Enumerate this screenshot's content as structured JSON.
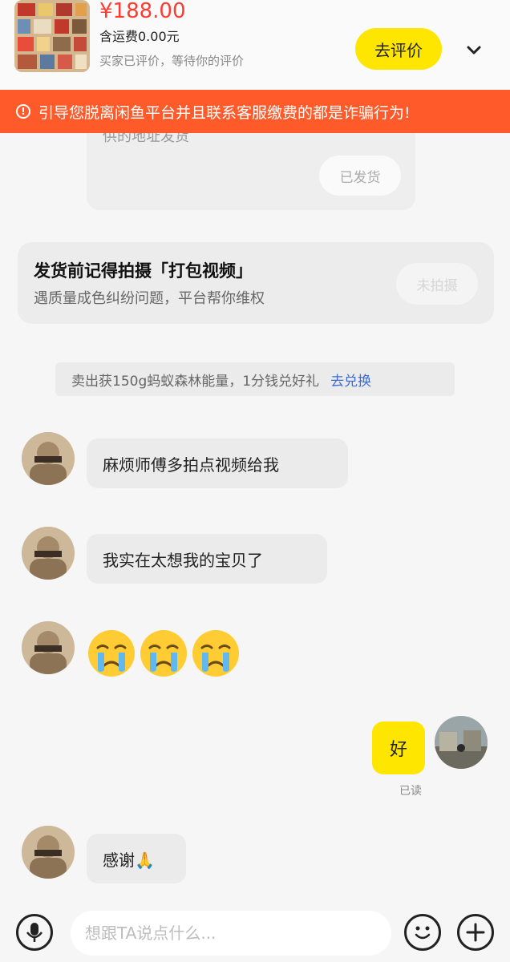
{
  "product": {
    "price": "¥188.00",
    "shipping": "含运费0.00元",
    "status": "买家已评价，等待你的评价",
    "review_button": "去评价"
  },
  "warning_banner": {
    "text": "引导您脱离闲鱼平台并且联系客服缴费的都是诈骗行为!"
  },
  "ship_card": {
    "partial_text": "供的地址发货",
    "button": "已发货"
  },
  "pack_card": {
    "title": "发货前记得拍摄「打包视频」",
    "subtitle": "遇质量成色纠纷问题，平台帮你维权",
    "button": "未拍摄"
  },
  "notice": {
    "text": "卖出获150g蚂蚁森林能量，1分钱兑好礼",
    "link": "去兑换"
  },
  "messages": {
    "m1": "麻烦师傅多拍点视频给我",
    "m2": "我实在太想我的宝贝了",
    "m3_emoji": "crying-face-emoji x3",
    "m4_self": "好",
    "m4_read": "已读",
    "m5": "感谢🙏"
  },
  "input": {
    "placeholder": "想跟TA说点什么..."
  },
  "colors": {
    "accent_yellow": "#ffe600",
    "warning_orange": "#ff5a2a",
    "price_red": "#ff3b30",
    "link_blue": "#3b6bd6"
  }
}
